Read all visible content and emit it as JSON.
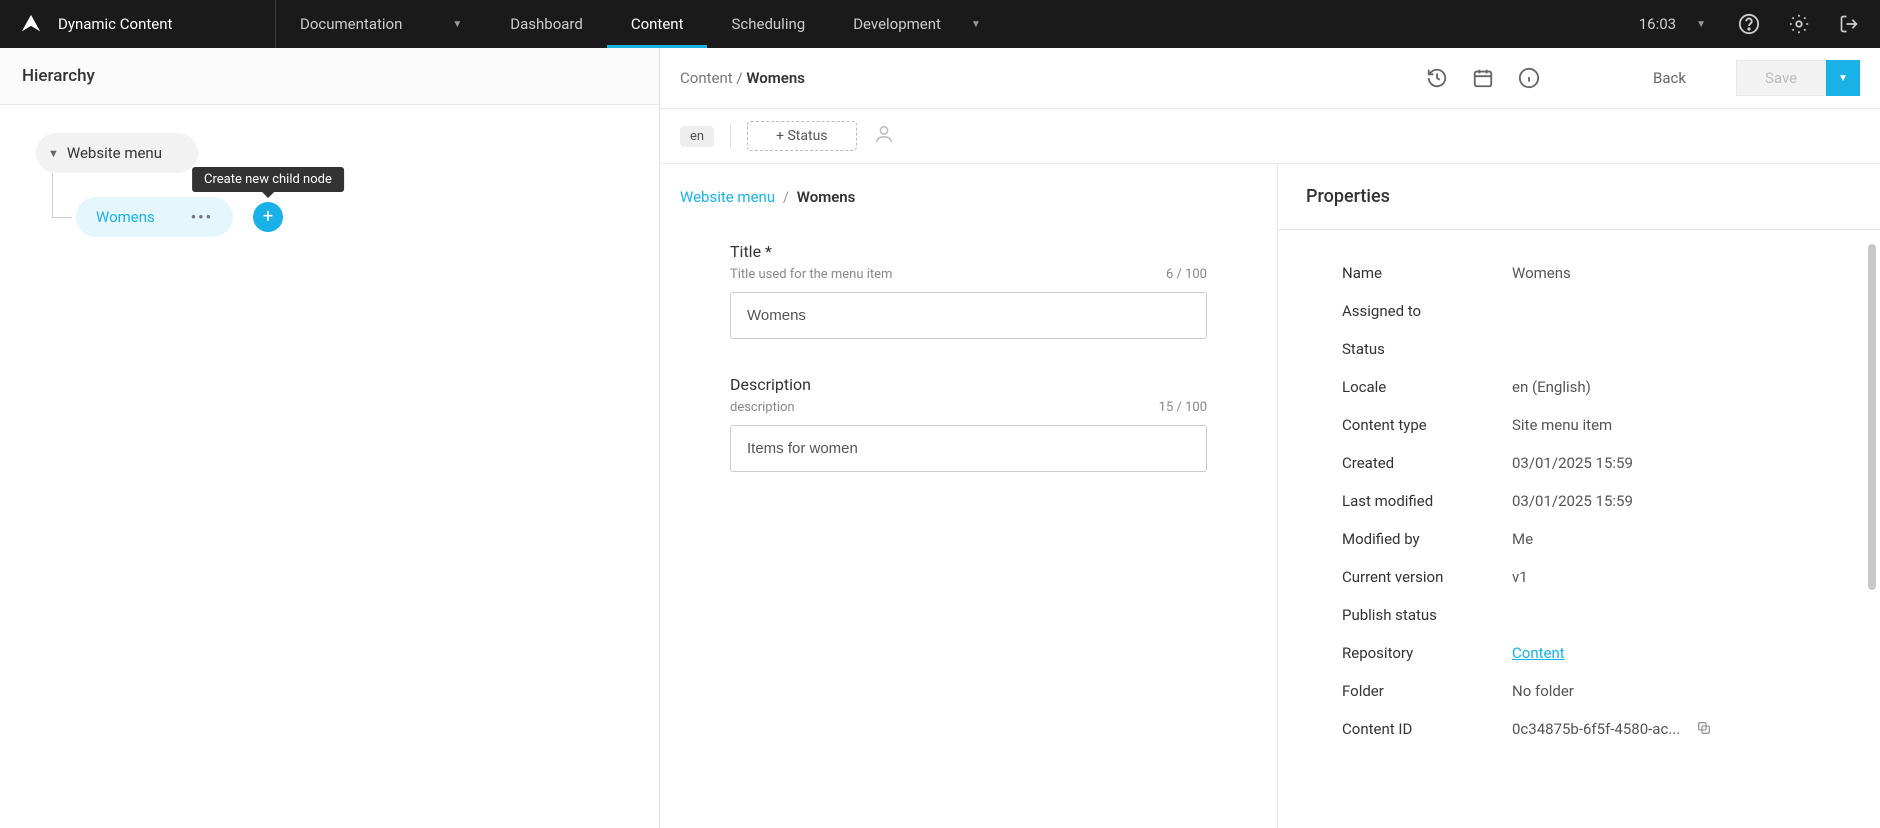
{
  "topbar": {
    "app_name": "Dynamic Content",
    "documentation_label": "Documentation",
    "nav": [
      {
        "label": "Dashboard",
        "active": false
      },
      {
        "label": "Content",
        "active": true
      },
      {
        "label": "Scheduling",
        "active": false
      },
      {
        "label": "Development",
        "active": false,
        "dropdown": true
      }
    ],
    "time": "16:03"
  },
  "sidebar": {
    "title": "Hierarchy",
    "root_label": "Website menu",
    "child_label": "Womens",
    "add_tooltip": "Create new child node"
  },
  "editor": {
    "breadcrumb_top_parent": "Content",
    "breadcrumb_top_current": "Womens",
    "back_label": "Back",
    "save_label": "Save",
    "locale_pill": "en",
    "add_status_label": "+ Status",
    "breadcrumb_form_parent": "Website menu",
    "breadcrumb_form_current": "Womens"
  },
  "form": {
    "title": {
      "label": "Title *",
      "hint": "Title used for the menu item",
      "counter": "6 / 100",
      "value": "Womens"
    },
    "description": {
      "label": "Description",
      "hint": "description",
      "counter": "15 / 100",
      "value": "Items for women"
    }
  },
  "properties": {
    "panel_title": "Properties",
    "rows": {
      "name": {
        "label": "Name",
        "value": "Womens"
      },
      "assigned_to": {
        "label": "Assigned to",
        "value": ""
      },
      "status": {
        "label": "Status",
        "value": ""
      },
      "locale": {
        "label": "Locale",
        "value": "en (English)"
      },
      "content_type": {
        "label": "Content type",
        "value": "Site menu item"
      },
      "created": {
        "label": "Created",
        "value": "03/01/2025 15:59"
      },
      "last_modified": {
        "label": "Last modified",
        "value": "03/01/2025 15:59"
      },
      "modified_by": {
        "label": "Modified by",
        "value": "Me"
      },
      "current_version": {
        "label": "Current version",
        "value": "v1"
      },
      "publish_status": {
        "label": "Publish status",
        "value": ""
      },
      "repository": {
        "label": "Repository",
        "value": "Content"
      },
      "folder": {
        "label": "Folder",
        "value": "No folder"
      },
      "content_id": {
        "label": "Content ID",
        "value": "0c34875b-6f5f-4580-ac..."
      }
    }
  }
}
